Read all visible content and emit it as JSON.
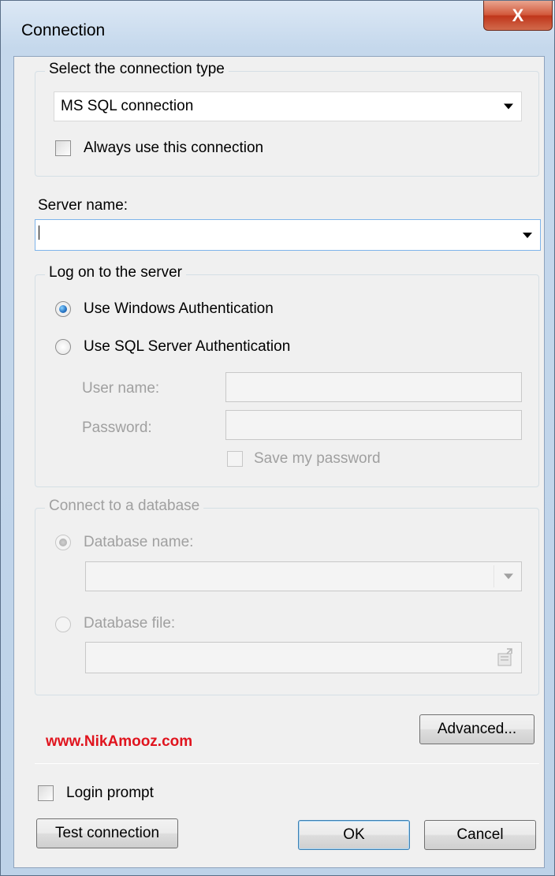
{
  "window": {
    "title": "Connection",
    "close_glyph": "X"
  },
  "connection_type": {
    "group_title": "Select the connection type",
    "selected": "MS SQL connection",
    "always_use_label": "Always use this connection"
  },
  "server": {
    "label": "Server name:",
    "value": ""
  },
  "logon": {
    "group_title": "Log on to the server",
    "windows_auth_label": "Use Windows Authentication",
    "sql_auth_label": "Use SQL Server Authentication",
    "username_label": "User name:",
    "password_label": "Password:",
    "save_password_label": "Save my password"
  },
  "database": {
    "group_title": "Connect to a database",
    "db_name_label": "Database name:",
    "db_file_label": "Database file:"
  },
  "buttons": {
    "advanced": "Advanced...",
    "test_connection": "Test connection",
    "ok": "OK",
    "cancel": "Cancel"
  },
  "login_prompt_label": "Login prompt",
  "watermark": "www.NikAmooz.com",
  "colors": {
    "watermark": "#e0141e",
    "title_bar": "#c5d8ec",
    "close_button": "#c0361b"
  },
  "icons": [
    "close-icon",
    "dropdown-arrow-icon",
    "radio-icon",
    "checkbox-icon",
    "folder-browse-icon"
  ]
}
